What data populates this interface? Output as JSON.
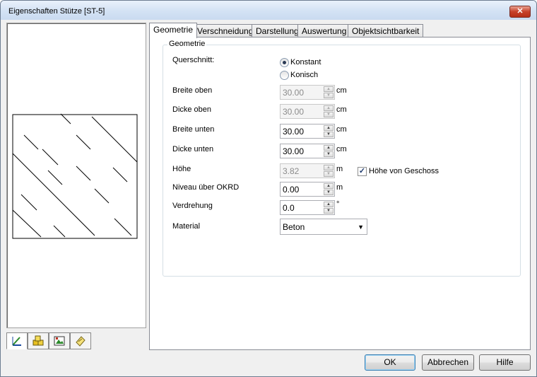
{
  "window": {
    "title": "Eigenschaften Stütze [ST-5]",
    "close_label": "✕"
  },
  "tabs": [
    {
      "label": "Geometrie",
      "active": true
    },
    {
      "label": "Verschneidung"
    },
    {
      "label": "Darstellung"
    },
    {
      "label": "Auswertung"
    },
    {
      "label": "Objektsichtbarkeit"
    }
  ],
  "geometry": {
    "group_title": "Geometrie",
    "querschnitt_label": "Querschnitt:",
    "radio_konstant": "Konstant",
    "radio_konisch": "Konisch",
    "selected": "Konstant",
    "fields": [
      {
        "label": "Breite oben",
        "value": "30.00",
        "unit": "cm",
        "enabled": false
      },
      {
        "label": "Dicke oben",
        "value": "30.00",
        "unit": "cm",
        "enabled": false
      },
      {
        "label": "Breite unten",
        "value": "30.00",
        "unit": "cm",
        "enabled": true
      },
      {
        "label": "Dicke unten",
        "value": "30.00",
        "unit": "cm",
        "enabled": true
      },
      {
        "label": "Höhe",
        "value": "3.82",
        "unit": "m",
        "enabled": false
      },
      {
        "label": "Niveau über OKRD",
        "value": "0.00",
        "unit": "m",
        "enabled": true
      },
      {
        "label": "Verdrehung",
        "value": "0.0",
        "unit": "°",
        "enabled": true
      }
    ],
    "hoehe_von_geschoss_label": "Höhe von Geschoss",
    "hoehe_von_geschoss_checked": true,
    "material_label": "Material",
    "material_value": "Beton"
  },
  "buttons": {
    "ok": "OK",
    "cancel": "Abbrechen",
    "help": "Hilfe"
  },
  "preview_tabs": [
    "geometry-icon",
    "materials-icon",
    "image-icon",
    "notes-icon"
  ]
}
